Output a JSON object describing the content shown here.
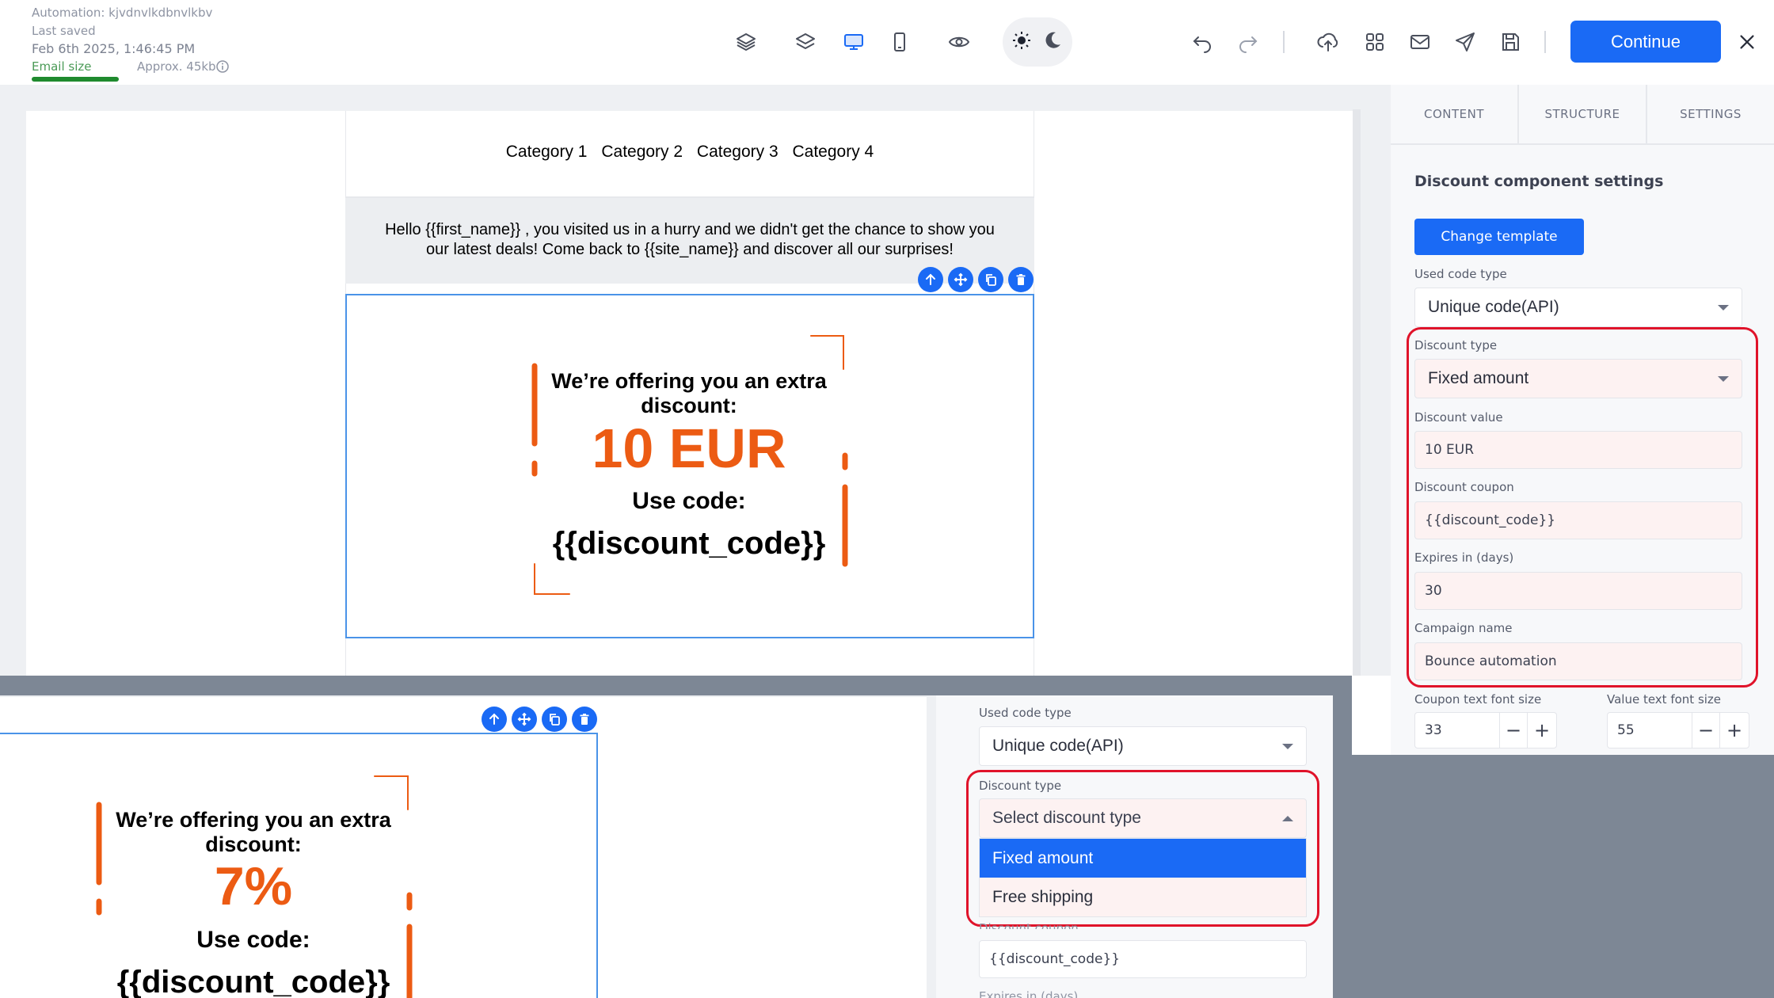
{
  "header": {
    "automation_label": "Automation: kjvdnvlkdbnvlkbv",
    "last_saved_label": "Last saved",
    "last_saved_date": "Feb 6th 2025, 1:46:45 PM",
    "email_size_label": "Email size",
    "email_size_value": "Approx. 45kb",
    "email_size_fraction": 1.0,
    "continue_label": "Continue",
    "toolbar_icons": [
      "layers-stack-icon",
      "layers-icon",
      "desktop-icon",
      "mobile-icon",
      "preview-eye-icon",
      "sun-icon",
      "moon-icon",
      "undo-icon",
      "redo-icon",
      "upload-icon",
      "grid-icon",
      "mail-icon",
      "send-icon",
      "save-icon",
      "close-icon"
    ]
  },
  "email": {
    "categories": [
      "Category 1",
      "Category 2",
      "Category 3",
      "Category 4"
    ],
    "hello_line1": "Hello {{first_name}}  , you visited us in a hurry and we didn't get the chance to show you",
    "hello_line2": "our latest deals! Come back to {{site_name}} and discover all our surprises!",
    "offer_line1": "We’re offering you an extra",
    "offer_line2": "discount:",
    "offer_value": "10 EUR",
    "use_code": "Use code:",
    "discount_code": "{{discount_code}}",
    "accent_color": "#ec5b13"
  },
  "panel": {
    "tabs": [
      "CONTENT",
      "STRUCTURE",
      "SETTINGS"
    ],
    "title": "Discount component settings",
    "change_template": "Change template",
    "used_code_type_label": "Used code type",
    "used_code_type_value": "Unique code(API)",
    "discount_type_label": "Discount type",
    "discount_type_value": "Fixed amount",
    "discount_value_label": "Discount value",
    "discount_value": "10 EUR",
    "discount_coupon_label": "Discount coupon",
    "discount_coupon": "{{discount_code}}",
    "expires_label": "Expires in (days)",
    "expires_value": "30",
    "campaign_label": "Campaign name",
    "campaign_value": "Bounce automation",
    "coupon_font_label": "Coupon text font size",
    "coupon_font_value": "33",
    "value_font_label": "Value text font size",
    "value_font_value": "55",
    "minus": "−",
    "plus": "+",
    "highlight_color": "#e0132a",
    "primary_color": "#1a6af5"
  },
  "overlay": {
    "offer_line1": "We’re offering you an extra",
    "offer_line2": "discount:",
    "offer_value": "7%",
    "use_code": "Use code:",
    "discount_code": "{{discount_code}}",
    "used_code_type_label": "Used code type",
    "used_code_type_value": "Unique code(API)",
    "discount_type_label": "Discount type",
    "discount_type_placeholder": "Select discount type",
    "options": [
      "Fixed amount",
      "Free shipping"
    ],
    "selected_option": "Fixed amount",
    "discount_coupon_label": "Discount coupon",
    "discount_coupon": "{{discount_code}}",
    "expires_label": "Expires in (days)"
  }
}
